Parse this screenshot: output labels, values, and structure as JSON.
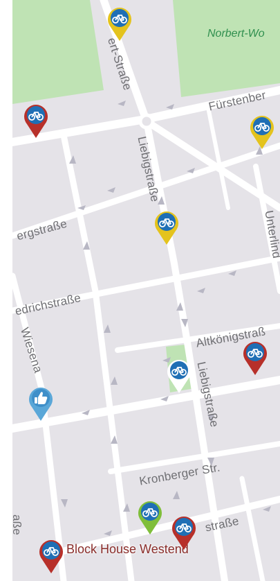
{
  "map": {
    "colors": {
      "land": "#e5e3e8",
      "road": "#ffffff",
      "park": "#bfe3b4",
      "arrow": "#b8b7c4",
      "label": "#6f6f73",
      "park_label": "#2f8f4e",
      "poi_label": "#8a2d2a"
    },
    "streets": [
      {
        "id": "street-top",
        "text": "ert-Straße"
      },
      {
        "id": "street-fuerstenberg",
        "text": "Fürstenber"
      },
      {
        "id": "street-liebig-1",
        "text": "Liebigstraße"
      },
      {
        "id": "street-berg",
        "text": "ergstraße"
      },
      {
        "id": "street-unterlind",
        "text": "Unterlind"
      },
      {
        "id": "street-friedrich",
        "text": "edrichstraße"
      },
      {
        "id": "street-altkoenig",
        "text": "Altkönigstraß"
      },
      {
        "id": "street-wiesen",
        "text": "Wiesena"
      },
      {
        "id": "street-liebig-2",
        "text": "Liebigstraße"
      },
      {
        "id": "street-kronberger",
        "text": "Kronberger Str."
      },
      {
        "id": "street-staufen",
        "text": "straße"
      },
      {
        "id": "street-left-edge",
        "text": "aße"
      }
    ],
    "park_label": "Norbert-Wo",
    "poi_label": "Block House Westend",
    "markers": [
      {
        "name": "bike-marker-yellow-top",
        "kind": "bike-icon",
        "color": "#e4c31d"
      },
      {
        "name": "bike-marker-red-left",
        "kind": "bike-icon",
        "color": "#b7302a"
      },
      {
        "name": "bike-marker-yellow-right",
        "kind": "bike-icon",
        "color": "#e4c31d"
      },
      {
        "name": "bike-marker-yellow-center",
        "kind": "bike-icon",
        "color": "#e4c31d"
      },
      {
        "name": "bike-marker-red-mid",
        "kind": "bike-icon",
        "color": "#b7302a"
      },
      {
        "name": "bike-marker-white-park",
        "kind": "bike-icon",
        "color": "#ffffff"
      },
      {
        "name": "thumbs-up-marker",
        "kind": "thumbs-up-icon",
        "color": "#5aa7d8"
      },
      {
        "name": "bike-marker-green",
        "kind": "bike-icon",
        "color": "#7fbe3a"
      },
      {
        "name": "bike-marker-red-bottom",
        "kind": "bike-icon",
        "color": "#b7302a"
      },
      {
        "name": "bike-marker-red-poi",
        "kind": "bike-icon",
        "color": "#b7302a"
      }
    ]
  }
}
